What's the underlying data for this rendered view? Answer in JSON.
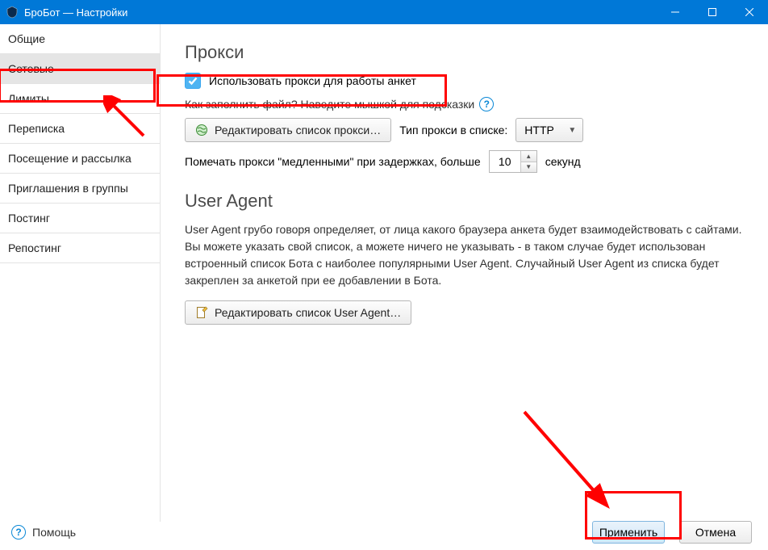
{
  "window": {
    "title": "БроБот — Настройки"
  },
  "sidebar": {
    "items": [
      {
        "label": "Общие"
      },
      {
        "label": "Сетевые"
      },
      {
        "label": "Лимиты"
      },
      {
        "label": "Переписка"
      },
      {
        "label": "Посещение и рассылка"
      },
      {
        "label": "Приглашения в группы"
      },
      {
        "label": "Постинг"
      },
      {
        "label": "Репостинг"
      }
    ],
    "selected_index": 1
  },
  "proxy": {
    "section_title": "Прокси",
    "use_proxy_label": "Использовать прокси для работы анкет",
    "hint_text": "Как заполнить файл? Наведите мышкой для подсказки",
    "edit_list_button": "Редактировать список прокси…",
    "type_label": "Тип прокси в списке:",
    "type_value": "HTTP",
    "slow_label_pre": "Помечать прокси \"медленными\" при задержках, больше",
    "slow_value": "10",
    "slow_label_post": "секунд"
  },
  "user_agent": {
    "section_title": "User Agent",
    "description": "User Agent грубо говоря определяет, от лица какого браузера анкета будет взаимодействовать с сайтами. Вы можете указать свой список, а можете ничего не указывать - в таком случае будет использован встроенный список Бота с наиболее популярными User Agent. Случайный User Agent из списка будет закреплен за анкетой при ее добавлении в Бота.",
    "edit_button": "Редактировать список User Agent…"
  },
  "footer": {
    "help": "Помощь",
    "apply": "Применить",
    "cancel": "Отмена"
  }
}
